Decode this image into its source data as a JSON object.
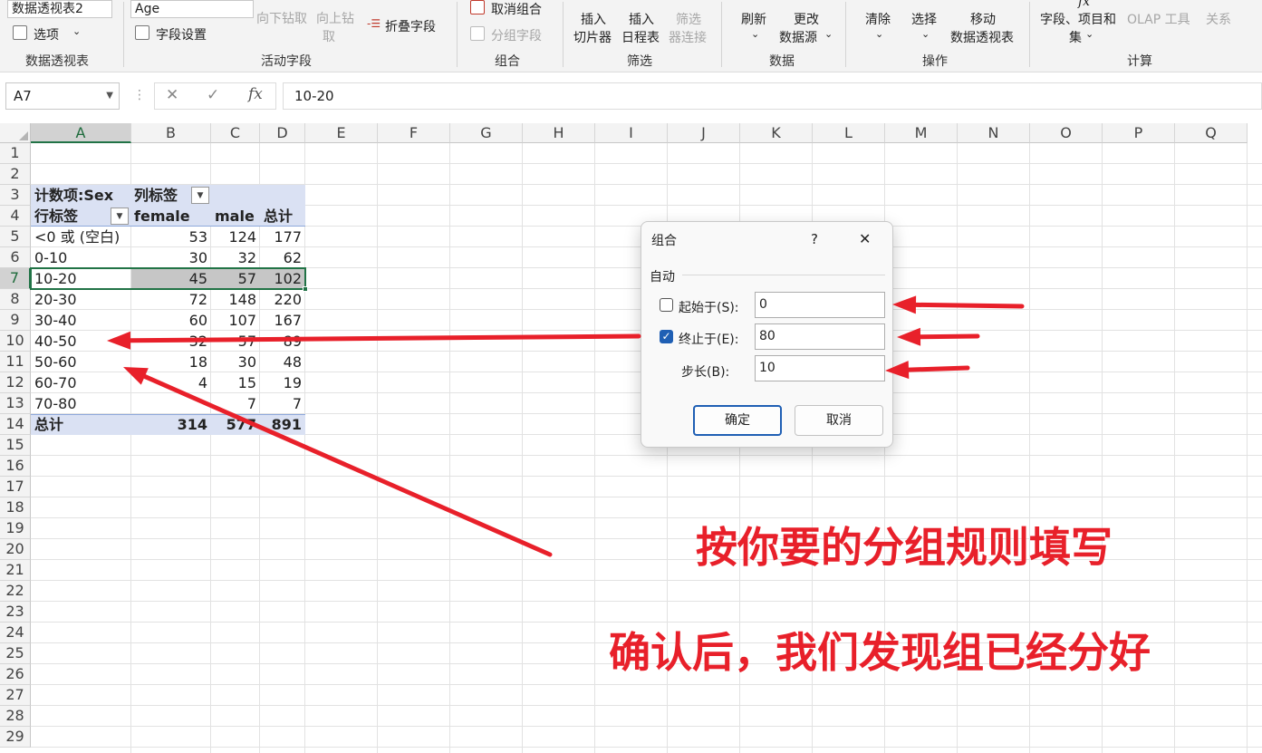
{
  "ribbon": {
    "pivot_name": "数据透视表2",
    "options_label": "选项",
    "active_field_value": "Age",
    "drill_down_label": "向下钻取",
    "drill_up_label_line1": "向上钻",
    "drill_up_label_line2": "取",
    "collapse_field_label": "折叠字段",
    "field_settings_label": "字段设置",
    "ungroup_label": "取消组合",
    "group_field_label": "分组字段",
    "insert_slicer_line1": "插入",
    "insert_slicer_line2": "切片器",
    "insert_timeline_line1": "插入",
    "insert_timeline_line2": "日程表",
    "filter_conn_line1": "筛选",
    "filter_conn_line2": "器连接",
    "refresh_label": "刷新",
    "change_source_line1": "更改",
    "change_source_line2": "数据源",
    "clear_label": "清除",
    "select_label": "选择",
    "move_line1": "移动",
    "move_line2": "数据透视表",
    "fields_items_line1": "字段、项目和",
    "fields_items_line2": "集",
    "olap_label": "OLAP 工具",
    "relations_label": "关系",
    "group_labels": {
      "pivot": "数据透视表",
      "active_field": "活动字段",
      "group": "组合",
      "filter": "筛选",
      "data": "数据",
      "actions": "操作",
      "calc": "计算"
    }
  },
  "formula_bar": {
    "name_box": "A7",
    "cancel_glyph": "✕",
    "enter_glyph": "✓",
    "fx_glyph": "fx",
    "formula": "10-20"
  },
  "grid": {
    "columns": [
      "A",
      "B",
      "C",
      "D",
      "E",
      "F",
      "G",
      "H",
      "I",
      "J",
      "K",
      "L",
      "M",
      "N",
      "O",
      "P",
      "Q"
    ],
    "rows": [
      "1",
      "2",
      "3",
      "4",
      "5",
      "6",
      "7",
      "8",
      "9",
      "10",
      "11",
      "12",
      "13",
      "14",
      "15",
      "16",
      "17",
      "18",
      "19",
      "20",
      "21",
      "22",
      "23",
      "24",
      "25",
      "26",
      "27",
      "28",
      "29"
    ],
    "selected_cell": "A7"
  },
  "pivot": {
    "value_field": "计数项:Sex",
    "col_label": "列标签",
    "row_label": "行标签",
    "headers": [
      "female",
      "male",
      "总计"
    ],
    "rows": [
      {
        "label": "<0 或 (空白)",
        "female": "53",
        "male": "124",
        "total": "177"
      },
      {
        "label": "0-10",
        "female": "30",
        "male": "32",
        "total": "62"
      },
      {
        "label": "10-20",
        "female": "45",
        "male": "57",
        "total": "102"
      },
      {
        "label": "20-30",
        "female": "72",
        "male": "148",
        "total": "220"
      },
      {
        "label": "30-40",
        "female": "60",
        "male": "107",
        "total": "167"
      },
      {
        "label": "40-50",
        "female": "32",
        "male": "57",
        "total": "89"
      },
      {
        "label": "50-60",
        "female": "18",
        "male": "30",
        "total": "48"
      },
      {
        "label": "60-70",
        "female": "4",
        "male": "15",
        "total": "19"
      },
      {
        "label": "70-80",
        "female": "",
        "male": "7",
        "total": "7"
      }
    ],
    "total_row": {
      "label": "总计",
      "female": "314",
      "male": "577",
      "total": "891"
    }
  },
  "dialog": {
    "title": "组合",
    "help_glyph": "?",
    "close_glyph": "✕",
    "section_label": "自动",
    "start_label": "起始于(S):",
    "start_value": "0",
    "start_checked": false,
    "end_label": "终止于(E):",
    "end_value": "80",
    "end_checked": true,
    "step_label": "步长(B):",
    "step_value": "10",
    "ok_label": "确定",
    "cancel_label": "取消"
  },
  "annotations": {
    "line1": "按你要的分组规则填写",
    "line2": "确认后，我们发现组已经分好",
    "color": "#e8202a"
  }
}
